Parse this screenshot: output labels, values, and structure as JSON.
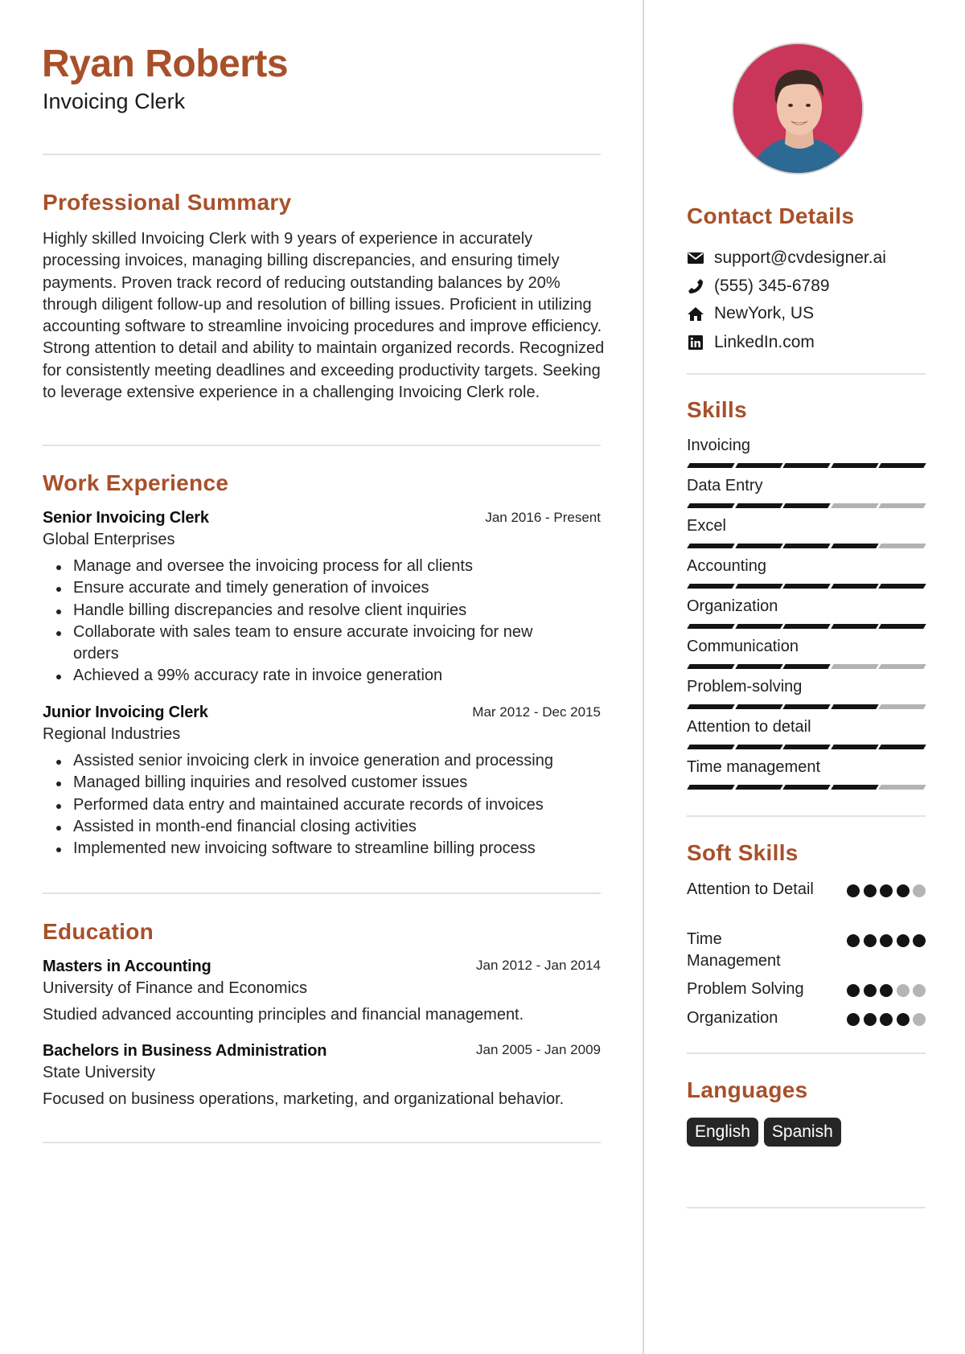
{
  "header": {
    "name": "Ryan Roberts",
    "title": "Invoicing Clerk"
  },
  "colors": {
    "accent": "#a8502a",
    "filled": "#141414",
    "empty": "#b3b3b3",
    "photo_bg": "#c9365a"
  },
  "summary": {
    "heading": "Professional Summary",
    "text": "Highly skilled Invoicing Clerk with 9 years of experience in accurately processing invoices, managing billing discrepancies, and ensuring timely payments. Proven track record of reducing outstanding balances by 20% through diligent follow-up and resolution of billing issues. Proficient in utilizing accounting software to streamline invoicing procedures and improve efficiency. Strong attention to detail and ability to maintain organized records. Recognized for consistently meeting deadlines and exceeding productivity targets. Seeking to leverage extensive experience in a challenging Invoicing Clerk role."
  },
  "experience": {
    "heading": "Work Experience",
    "jobs": [
      {
        "title": "Senior Invoicing Clerk",
        "company": "Global Enterprises",
        "dates": "Jan 2016 - Present",
        "bullets": [
          "Manage and oversee the invoicing process for all clients",
          "Ensure accurate and timely generation of invoices",
          "Handle billing discrepancies and resolve client inquiries",
          "Collaborate with sales team to ensure accurate invoicing for new orders",
          "Achieved a 99% accuracy rate in invoice generation"
        ]
      },
      {
        "title": "Junior Invoicing Clerk",
        "company": "Regional Industries",
        "dates": "Mar 2012 - Dec 2015",
        "bullets": [
          "Assisted senior invoicing clerk in invoice generation and processing",
          "Managed billing inquiries and resolved customer issues",
          "Performed data entry and maintained accurate records of invoices",
          "Assisted in month-end financial closing activities",
          "Implemented new invoicing software to streamline billing process"
        ]
      }
    ]
  },
  "education": {
    "heading": "Education",
    "items": [
      {
        "degree": "Masters in Accounting",
        "school": "University of Finance and Economics",
        "dates": "Jan 2012 - Jan 2014",
        "description": "Studied advanced accounting principles and financial management."
      },
      {
        "degree": "Bachelors in Business Administration",
        "school": "State University",
        "dates": "Jan 2005 - Jan 2009",
        "description": "Focused on business operations, marketing, and organizational behavior."
      }
    ]
  },
  "contact": {
    "heading": "Contact Details",
    "items": [
      {
        "icon": "envelope-icon",
        "text": "support@cvdesigner.ai"
      },
      {
        "icon": "phone-icon",
        "text": "(555) 345-6789"
      },
      {
        "icon": "home-icon",
        "text": "NewYork, US"
      },
      {
        "icon": "linkedin-icon",
        "text": "LinkedIn.com"
      }
    ]
  },
  "skills": {
    "heading": "Skills",
    "max": 5,
    "items": [
      {
        "name": "Invoicing",
        "level": 5
      },
      {
        "name": "Data Entry",
        "level": 3
      },
      {
        "name": "Excel",
        "level": 4
      },
      {
        "name": "Accounting",
        "level": 5
      },
      {
        "name": "Organization",
        "level": 5
      },
      {
        "name": "Communication",
        "level": 3
      },
      {
        "name": "Problem-solving",
        "level": 4
      },
      {
        "name": "Attention to detail",
        "level": 5
      },
      {
        "name": "Time management",
        "level": 4
      }
    ]
  },
  "soft_skills": {
    "heading": "Soft Skills",
    "max": 5,
    "items": [
      {
        "name": "Attention to Detail",
        "level": 4
      },
      {
        "name": "Time Management",
        "level": 5
      },
      {
        "name": "Problem Solving",
        "level": 3
      },
      {
        "name": "Organization",
        "level": 4
      }
    ]
  },
  "languages": {
    "heading": "Languages",
    "items": [
      "English",
      "Spanish"
    ]
  }
}
